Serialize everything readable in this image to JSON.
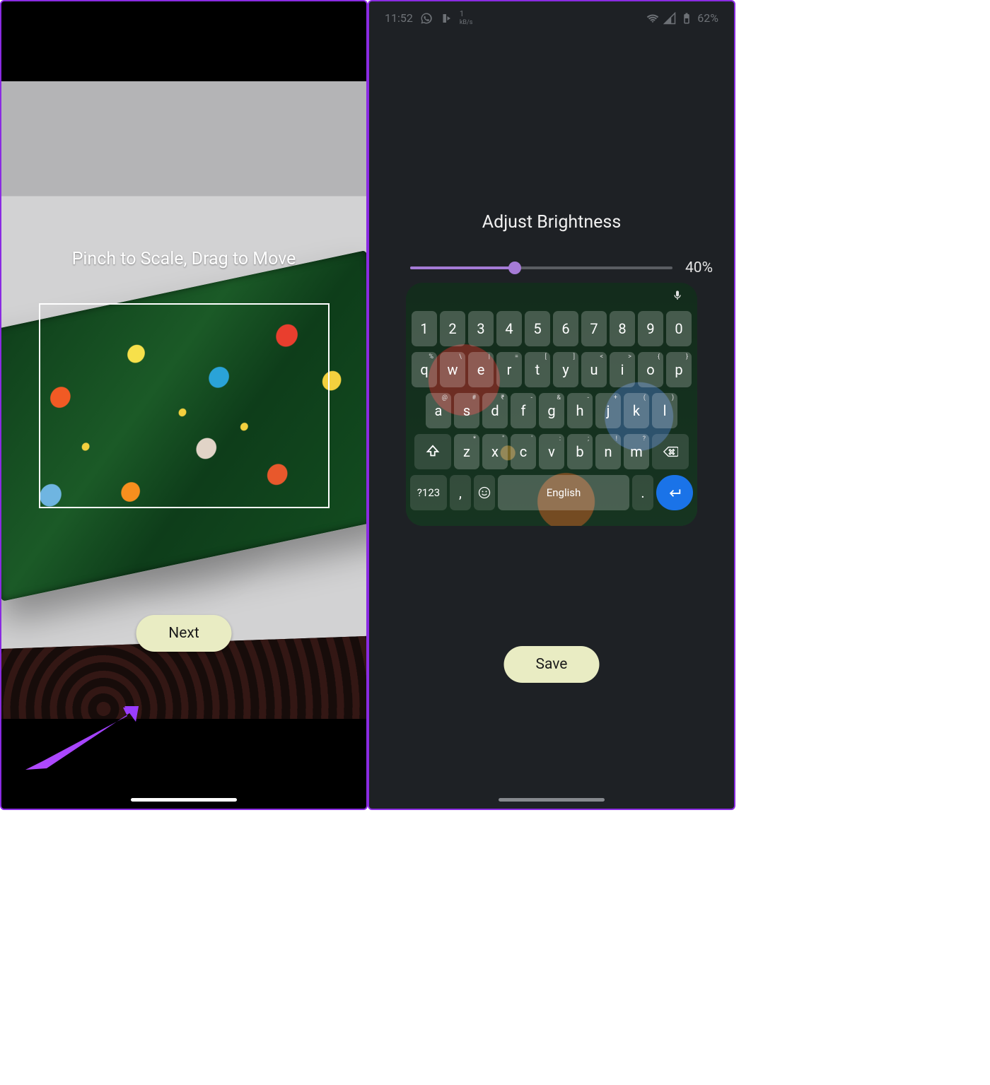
{
  "left": {
    "instruction": "Pinch to Scale, Drag to Move",
    "next_label": "Next"
  },
  "right": {
    "status": {
      "time": "11:52",
      "net_speed_value": "1",
      "net_speed_unit": "kB/s",
      "battery_pct": "62%"
    },
    "title": "Adjust Brightness",
    "brightness_pct": "40%",
    "save_label": "Save",
    "keyboard": {
      "row_num": [
        "1",
        "2",
        "3",
        "4",
        "5",
        "6",
        "7",
        "8",
        "9",
        "0"
      ],
      "row_top": [
        {
          "k": "q",
          "h": "%"
        },
        {
          "k": "w",
          "h": "\\"
        },
        {
          "k": "e",
          "h": "|"
        },
        {
          "k": "r",
          "h": "="
        },
        {
          "k": "t",
          "h": "["
        },
        {
          "k": "y",
          "h": "]"
        },
        {
          "k": "u",
          "h": "<"
        },
        {
          "k": "i",
          "h": ">"
        },
        {
          "k": "o",
          "h": "{"
        },
        {
          "k": "p",
          "h": "}"
        }
      ],
      "row_mid": [
        {
          "k": "a",
          "h": "@"
        },
        {
          "k": "s",
          "h": "#"
        },
        {
          "k": "d",
          "h": "₹"
        },
        {
          "k": "f",
          "h": "-"
        },
        {
          "k": "g",
          "h": "&"
        },
        {
          "k": "h",
          "h": "-"
        },
        {
          "k": "j",
          "h": "+"
        },
        {
          "k": "k",
          "h": "("
        },
        {
          "k": "l",
          "h": ")"
        }
      ],
      "row_bot": [
        {
          "k": "z",
          "h": "*"
        },
        {
          "k": "x",
          "h": "\""
        },
        {
          "k": "c",
          "h": "'"
        },
        {
          "k": "v",
          "h": ":"
        },
        {
          "k": "b",
          "h": ";"
        },
        {
          "k": "n",
          "h": "!"
        },
        {
          "k": "m",
          "h": "?"
        }
      ],
      "sym_label": "?123",
      "space_label": "English",
      "comma": ",",
      "period": "."
    }
  }
}
